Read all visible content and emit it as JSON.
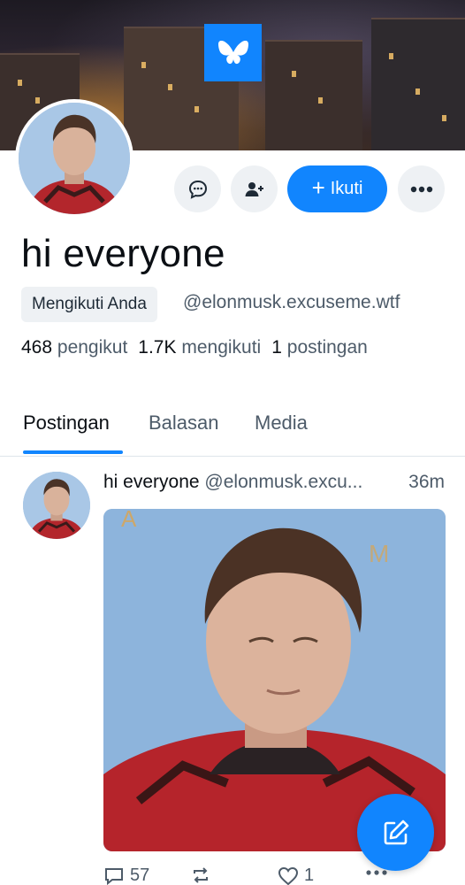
{
  "profile": {
    "display_name": "hi everyone",
    "handle": "@elonmusk.excuseme.wtf",
    "follows_you_badge": "Mengikuti Anda",
    "stats": {
      "followers_count": "468",
      "followers_label": "pengikut",
      "following_count": "1.7K",
      "following_label": "mengikuti",
      "posts_count": "1",
      "posts_label": "postingan"
    }
  },
  "actions": {
    "message_icon": "chat-bubble-icon",
    "add_user_icon": "person-plus-icon",
    "follow_label": "Ikuti",
    "more_icon": "ellipsis-icon"
  },
  "tabs": [
    {
      "label": "Postingan",
      "active": true
    },
    {
      "label": "Balasan",
      "active": false
    },
    {
      "label": "Media",
      "active": false
    }
  ],
  "post": {
    "author_name": "hi everyone",
    "author_handle": "@elonmusk.excu...",
    "time": "36m",
    "reply_count": "57",
    "like_count": "1"
  },
  "colors": {
    "accent": "#1185fe",
    "secondary_text": "#4d5b69",
    "button_bg": "#eef1f4"
  }
}
